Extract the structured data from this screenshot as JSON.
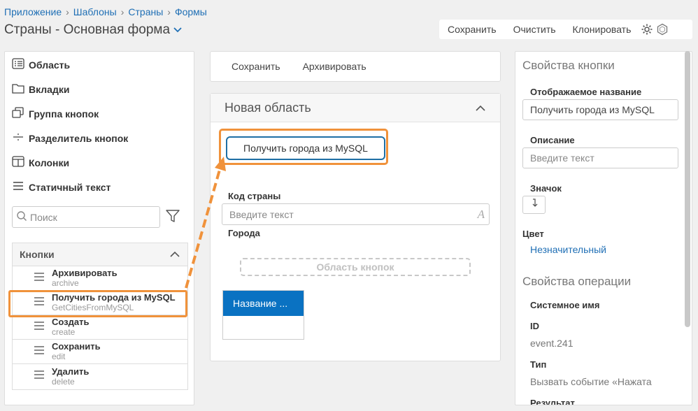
{
  "breadcrumb": [
    "Приложение",
    "Шаблоны",
    "Страны",
    "Формы"
  ],
  "breadcrumb_sep": "›",
  "title": "Страны - Основная форма",
  "top_toolbar": {
    "save": "Сохранить",
    "clear": "Очистить",
    "clone": "Клонировать"
  },
  "components": [
    {
      "label": "Область",
      "icon": "list-icon"
    },
    {
      "label": "Вкладки",
      "icon": "folder-icon"
    },
    {
      "label": "Группа кнопок",
      "icon": "copy-icon"
    },
    {
      "label": "Разделитель кнопок",
      "icon": "divider-icon"
    },
    {
      "label": "Колонки",
      "icon": "columns-icon"
    },
    {
      "label": "Статичный текст",
      "icon": "text-lines-icon"
    }
  ],
  "search": {
    "placeholder": "Поиск"
  },
  "buttons_section": {
    "title": "Кнопки",
    "items": [
      {
        "label": "Архивировать",
        "code": "archive"
      },
      {
        "label": "Получить города из MySQL",
        "code": "GetCitiesFromMySQL"
      },
      {
        "label": "Создать",
        "code": "create"
      },
      {
        "label": "Сохранить",
        "code": "edit"
      },
      {
        "label": "Удалить",
        "code": "delete"
      }
    ]
  },
  "center_toolbar": {
    "save": "Сохранить",
    "archive": "Архивировать"
  },
  "new_area": {
    "title": "Новая область",
    "button_label": "Получить города из MySQL",
    "country_code_label": "Код страны",
    "country_code_placeholder": "Введите текст",
    "cities_label": "Города",
    "button_area": "Область кнопок",
    "table_header": "Название ..."
  },
  "props": {
    "button_props_title": "Свойства кнопки",
    "display_name_label": "Отображаемое название",
    "display_name_value": "Получить города из MySQL",
    "description_label": "Описание",
    "description_placeholder": "Введите текст",
    "icon_label": "Значок",
    "color_label": "Цвет",
    "color_value": "Незначительный",
    "op_props_title": "Свойства операции",
    "system_name_label": "Системное имя",
    "id_label": "ID",
    "id_value": "event.241",
    "type_label": "Тип",
    "type_value": "Вызвать событие «Нажата",
    "result_label": "Результат"
  },
  "colors": {
    "accent": "#1f6fb5",
    "highlight": "#f0923b",
    "table_header": "#0a72c2"
  }
}
